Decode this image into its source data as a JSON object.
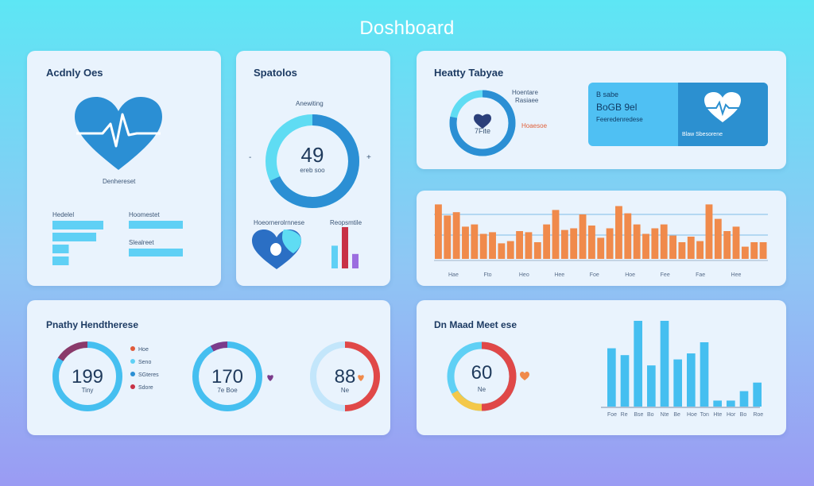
{
  "header": {
    "title": "Doshboard"
  },
  "activity": {
    "title": "Acdnly Oes",
    "heart_label": "Denhereset",
    "bars_left_label": "Hedelel",
    "bars_right_label": "Hoomestet",
    "bars_right_label2": "Slealreet",
    "bars_left": [
      1.0,
      0.86,
      0.32,
      0.32
    ],
    "bars_right": [
      1.0,
      1.0
    ],
    "colors": {
      "heart": "#2b8fd4",
      "bar": "#5fd0f5"
    }
  },
  "spatial": {
    "title": "Spatolos",
    "ring_caption": "Anewiting",
    "ring_value": "49",
    "ring_sub": "ereb soo",
    "ring_progress": 0.68,
    "left_mark": "-",
    "right_mark": "+",
    "legend_left": "Hoeornerolrnnese",
    "legend_right": "Reopsmtile",
    "mini_bars": [
      0.55,
      1.0,
      0.35
    ],
    "mini_bar_colors": [
      "#5fd0f5",
      "#c83246",
      "#9b6ee0"
    ]
  },
  "healthy": {
    "title": "Heatty Tabyae",
    "ring_value": "7Fite",
    "ring_progress": 0.78,
    "label1": "Hoentare",
    "label2": "Rasiaee",
    "label3": "Hoaesoe",
    "panel_line1": "B sabe",
    "panel_line2": "BoGB 9el",
    "panel_line3": "Feeredenredese",
    "panel_right_label": "Blaw Sbesorene",
    "colors": {
      "panel": "#4fc0f3",
      "panel_dark": "#2c90d0"
    }
  },
  "bars_chart": {
    "values": [
      0.98,
      0.78,
      0.84,
      0.58,
      0.62,
      0.45,
      0.48,
      0.28,
      0.32,
      0.5,
      0.48,
      0.3,
      0.62,
      0.88,
      0.52,
      0.55,
      0.8,
      0.6,
      0.38,
      0.55,
      0.95,
      0.82,
      0.62,
      0.45,
      0.55,
      0.62,
      0.42,
      0.3,
      0.4,
      0.32,
      0.98,
      0.72,
      0.5,
      0.58,
      0.22,
      0.3,
      0.3
    ],
    "x_ticks": [
      "Hae",
      "Fto",
      "Heo",
      "Hee",
      "Foe",
      "Hoe",
      "Fee",
      "Fae",
      "Hee"
    ],
    "colors": {
      "bar": "#f08a4b",
      "line": "#7fbde8"
    }
  },
  "heart_rate": {
    "title": "Pnathy Hendtherese",
    "legend": [
      "Hoe",
      "Seno",
      "SGteres",
      "Sdore"
    ],
    "legend_colors": [
      "#e05a3a",
      "#5fd0f5",
      "#2b8fd4",
      "#c83246"
    ],
    "rings": [
      {
        "value": "199",
        "sub": "Tiny",
        "progress": 0.84,
        "color": "#45bff0",
        "accent": "#8a3a6a"
      },
      {
        "value": "170",
        "sub": "7e Boe",
        "progress": 0.92,
        "color": "#45bff0",
        "accent": "#7b3b8b"
      },
      {
        "value": "88",
        "sub": "Ne",
        "progress": 0.5,
        "color": "#e04848",
        "accent": "#c3e6fb"
      }
    ]
  },
  "vital": {
    "title": "Dn Maad Meet ese",
    "ring_value": "60",
    "ring_sub": "Ne",
    "bars": [
      0.68,
      0.6,
      1.0,
      0.48,
      1.0,
      0.55,
      0.62,
      0.75,
      0.07,
      0.07,
      0.18,
      0.28
    ],
    "x_ticks": [
      "Foe",
      "Re",
      "Bse",
      "Bo",
      "Nte",
      "Be",
      "Hoe",
      "Ton",
      "Hte",
      "Hor",
      "Bo",
      "Roe"
    ],
    "colors": {
      "bar": "#45bff0"
    }
  }
}
